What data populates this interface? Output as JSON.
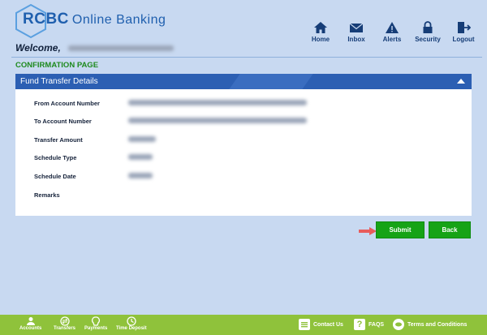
{
  "brand": {
    "name": "RCBC",
    "product": "Online Banking"
  },
  "header": {
    "welcome": "Welcome,"
  },
  "nav": [
    {
      "label": "Home",
      "icon": "home-icon"
    },
    {
      "label": "Inbox",
      "icon": "mail-icon"
    },
    {
      "label": "Alerts",
      "icon": "alert-icon"
    },
    {
      "label": "Security",
      "icon": "lock-icon"
    },
    {
      "label": "Logout",
      "icon": "logout-icon"
    }
  ],
  "page": {
    "title": "CONFIRMATION PAGE"
  },
  "panel": {
    "title": "Fund Transfer Details",
    "fields": [
      {
        "label": "From Account Number"
      },
      {
        "label": "To Account Number"
      },
      {
        "label": "Transfer Amount"
      },
      {
        "label": "Schedule Type"
      },
      {
        "label": "Schedule Date"
      },
      {
        "label": "Remarks"
      }
    ]
  },
  "actions": {
    "submit": "Submit",
    "back": "Back"
  },
  "footer": {
    "quick": [
      {
        "label": "Accounts",
        "icon": "accounts-icon"
      },
      {
        "label": "Transfers",
        "icon": "transfers-icon"
      },
      {
        "label": "Payments",
        "icon": "payments-icon"
      },
      {
        "label": "Time Deposit",
        "icon": "time-deposit-icon"
      }
    ],
    "links": [
      {
        "label": "Contact Us",
        "icon": "contact-icon"
      },
      {
        "label": "FAQS",
        "icon": "faq-icon"
      },
      {
        "label": "Terms and Conditions",
        "icon": "terms-icon"
      }
    ]
  },
  "colors": {
    "brand_blue": "#2c5fb3",
    "accent_green": "#16a316",
    "background": "#c8d9f1",
    "footer": "#8fc23b",
    "title_green": "#1e8a1e"
  }
}
